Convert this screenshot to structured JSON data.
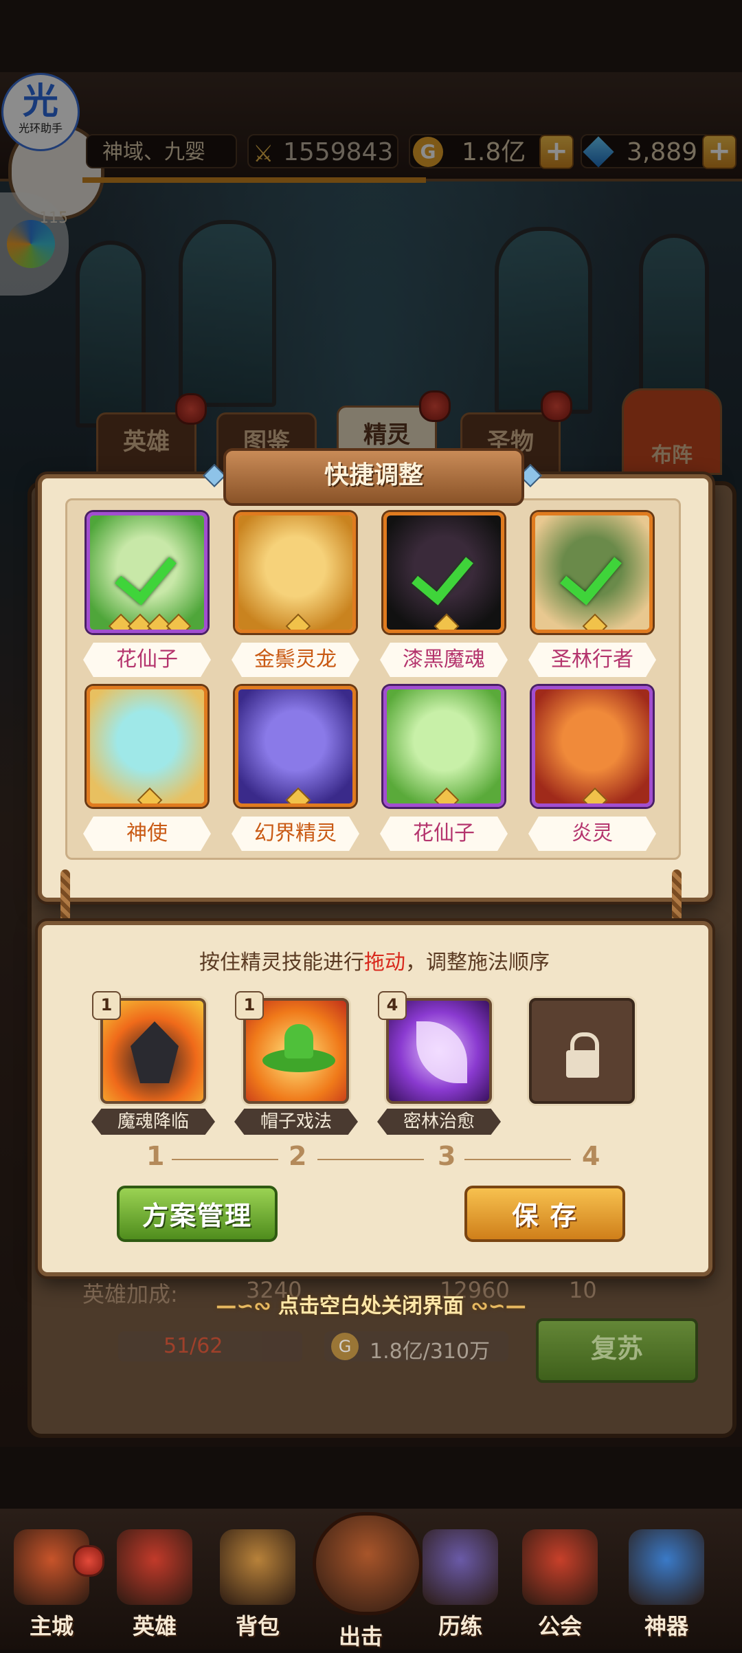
{
  "helper": {
    "glyph": "光",
    "label": "光环助手"
  },
  "topbar": {
    "region": "神域、九婴",
    "power": "1559843",
    "gold": "1.8亿",
    "gems": "3,889",
    "level": "115"
  },
  "tabs": [
    "英雄",
    "图鉴",
    "精灵",
    "圣物",
    "布阵"
  ],
  "quick_adjust": {
    "title": "快捷调整",
    "heroes": [
      {
        "name": "花仙子",
        "frame": "purple",
        "selected": true,
        "stars": 4,
        "name_color": "pink"
      },
      {
        "name": "金鬃灵龙",
        "frame": "orange",
        "selected": false,
        "stars": 1,
        "name_color": "orange"
      },
      {
        "name": "漆黑魔魂",
        "frame": "orange",
        "selected": true,
        "stars": 1,
        "name_color": "pink"
      },
      {
        "name": "圣林行者",
        "frame": "orange",
        "selected": true,
        "stars": 1,
        "name_color": "pink"
      },
      {
        "name": "神使",
        "frame": "orange",
        "selected": false,
        "stars": 1,
        "name_color": "orange"
      },
      {
        "name": "幻界精灵",
        "frame": "orange",
        "selected": false,
        "stars": 1,
        "name_color": "orange"
      },
      {
        "name": "花仙子",
        "frame": "purple",
        "selected": false,
        "stars": 1,
        "name_color": "pink"
      },
      {
        "name": "炎灵",
        "frame": "purple",
        "selected": false,
        "stars": 1,
        "name_color": "pink"
      }
    ]
  },
  "skill_order": {
    "instruction_prefix": "按住精灵技能进行",
    "instruction_highlight": "拖动",
    "instruction_suffix": "，调整施法顺序",
    "skills": [
      {
        "badge": "1",
        "name": "魔魂降临"
      },
      {
        "badge": "1",
        "name": "帽子戏法"
      },
      {
        "badge": "4",
        "name": "密林治愈"
      }
    ],
    "order_numbers": [
      "1",
      "2",
      "3",
      "4"
    ],
    "plan_button": "方案管理",
    "save_button": "保 存"
  },
  "lower": {
    "hero_bonus_label": "英雄加成:",
    "bonus_values": [
      "3240",
      "12960",
      "10"
    ],
    "close_hint": "点击空白处关闭界面",
    "stamina": "51/62",
    "cost": "1.8亿/310万",
    "revive_button": "复苏"
  },
  "nav": [
    "主城",
    "英雄",
    "背包",
    "出击",
    "历练",
    "公会",
    "神器"
  ],
  "colors": {
    "accent_orange": "#e07b1f",
    "accent_purple": "#a24ed0",
    "highlight_red": "#d8281c",
    "check_green": "#3fd43a"
  }
}
